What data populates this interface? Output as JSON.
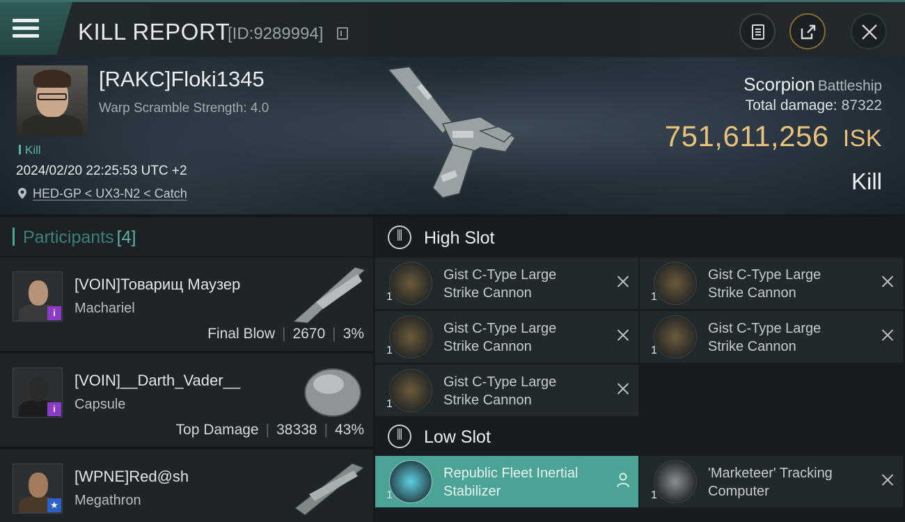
{
  "header": {
    "title": "KILL REPORT",
    "report_id": "[ID:9289994]"
  },
  "victim": {
    "name": "[RAKC]Floki1345",
    "warp_scramble": "Warp Scramble Strength: 4.0",
    "kill_tag": "Kill",
    "time": "2024/02/20 22:25:53 UTC +2",
    "location": "HED-GP < UX3-N2 < Catch",
    "ship": "Scorpion",
    "ship_class": "Battleship",
    "total_damage_label": "Total damage:",
    "total_damage": "87322",
    "isk_value": "751,611,256",
    "isk_unit": "ISK",
    "result": "Kill"
  },
  "participants": {
    "label": "Participants",
    "count": "[4]",
    "rows": [
      {
        "name": "[VOIN]Товарищ Маузер",
        "ship": "Machariel",
        "role": "Final Blow",
        "damage": "2670",
        "percent": "3%",
        "badge": "i"
      },
      {
        "name": "[VOIN]__Darth_Vader__",
        "ship": "Capsule",
        "role": "Top Damage",
        "damage": "38338",
        "percent": "43%",
        "badge": "i"
      },
      {
        "name": "[WPNE]Red@sh",
        "ship": "Megathron",
        "badge": "★"
      }
    ]
  },
  "slots": {
    "high": {
      "label": "High Slot",
      "modules": [
        {
          "qty": "1",
          "line1": "Gist C-Type Large",
          "line2": "Strike Cannon"
        },
        {
          "qty": "1",
          "line1": "Gist C-Type Large",
          "line2": "Strike Cannon"
        },
        {
          "qty": "1",
          "line1": "Gist C-Type Large",
          "line2": "Strike Cannon"
        },
        {
          "qty": "1",
          "line1": "Gist C-Type Large",
          "line2": "Strike Cannon"
        },
        {
          "qty": "1",
          "line1": "Gist C-Type Large",
          "line2": "Strike Cannon"
        }
      ]
    },
    "low": {
      "label": "Low Slot",
      "modules": [
        {
          "qty": "1",
          "line1": "Republic Fleet Inertial",
          "line2": "Stabilizer"
        },
        {
          "qty": "1",
          "line1": "'Marketeer' Tracking",
          "line2": "Computer"
        }
      ]
    }
  },
  "colors": {
    "accent_teal": "#4aa394",
    "isk_gold": "#e8c27a",
    "badge_purple": "#8c3bc9",
    "badge_blue": "#2f62c9"
  },
  "icons": [
    "menu-icon",
    "copy-icon",
    "report-icon",
    "share-icon",
    "close-icon",
    "location-pin-icon",
    "slot-icon",
    "destroyed-x-icon",
    "dropped-person-icon"
  ]
}
